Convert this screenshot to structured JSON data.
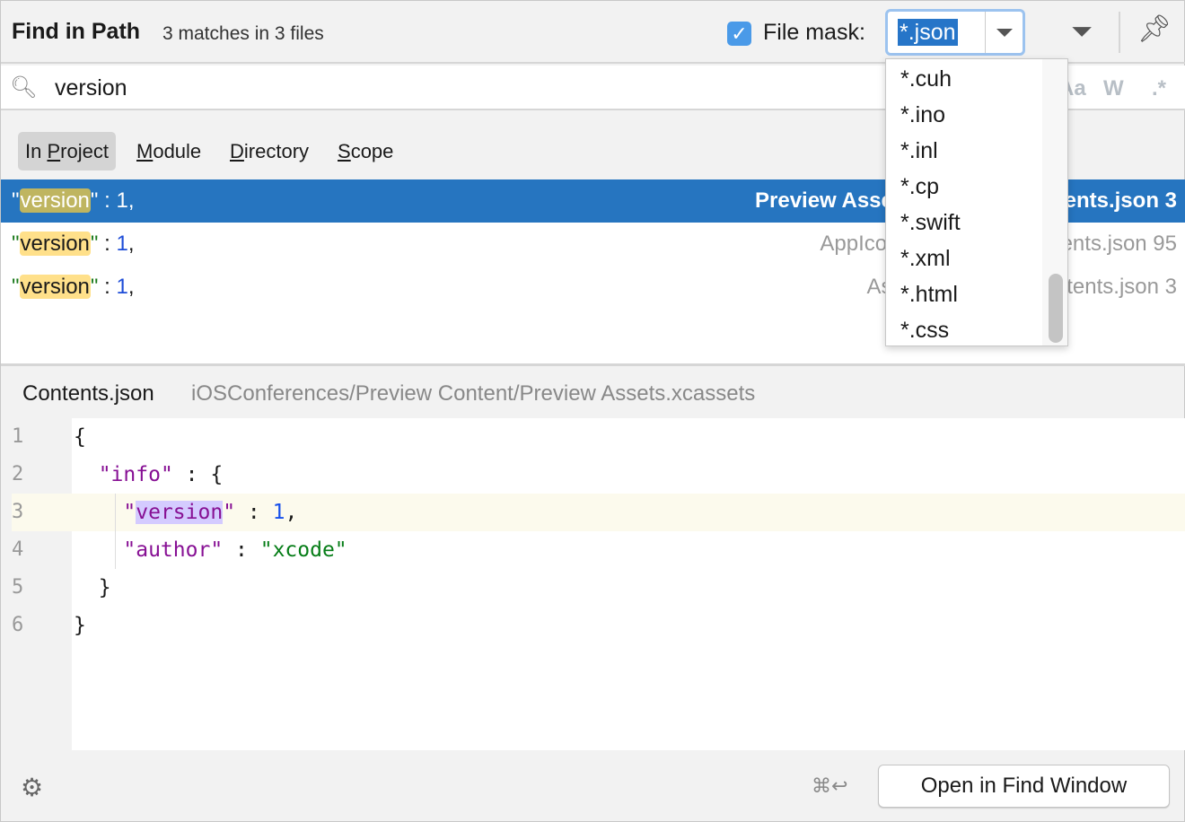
{
  "header": {
    "title": "Find in Path",
    "match_count": "3 matches in 3 files",
    "file_mask_checked": true,
    "file_mask_label": "File mask:",
    "file_mask_value": "*.json"
  },
  "search": {
    "value": "version",
    "options": {
      "match_case": "Aa",
      "words": "W",
      "regex": ".*"
    }
  },
  "scope_tabs": [
    {
      "pre": "In ",
      "key": "P",
      "post": "roject",
      "active": true
    },
    {
      "pre": "",
      "key": "M",
      "post": "odule"
    },
    {
      "pre": "",
      "key": "D",
      "post": "irectory"
    },
    {
      "pre": "",
      "key": "S",
      "post": "cope"
    }
  ],
  "results": [
    {
      "q1": "\"",
      "match": "version",
      "q2": "\"",
      "rest": " : ",
      "num": "1",
      "comma": ",",
      "location": "Preview Assets.xcassets/Contents.json 3",
      "selected": true
    },
    {
      "q1": "\"",
      "match": "version",
      "q2": "\"",
      "rest": " : ",
      "num": "1",
      "comma": ",",
      "location": "AppIcon.appiconset/Contents.json 95"
    },
    {
      "q1": "\"",
      "match": "version",
      "q2": "\"",
      "rest": " : ",
      "num": "1",
      "comma": ",",
      "location": "Assets.xcassets/Contents.json 3"
    }
  ],
  "mask_dropdown": [
    "*.cuh",
    "*.ino",
    "*.inl",
    "*.cp",
    "*.swift",
    "*.xml",
    "*.html",
    "*.css"
  ],
  "preview": {
    "file_name": "Contents.json",
    "file_path": "iOSConferences/Preview Content/Preview Assets.xcassets",
    "line_numbers": [
      "1",
      "2",
      "3",
      "4",
      "5",
      "6"
    ],
    "code": {
      "l1": "{",
      "l2_indent": "  ",
      "l2_key": "\"info\"",
      "l2_rest": " : {",
      "l3_indent": "    ",
      "l3_q1": "\"",
      "l3_key": "version",
      "l3_q2": "\"",
      "l3_rest": " : ",
      "l3_num": "1",
      "l3_comma": ",",
      "l4_indent": "    ",
      "l4_key": "\"author\"",
      "l4_rest": " : ",
      "l4_val": "\"xcode\"",
      "l5": "  }",
      "l6": "}"
    }
  },
  "footer": {
    "shortcut": "⌘↩",
    "open_button": "Open in Find Window"
  },
  "colors": {
    "accent": "#2675c0",
    "match_highlight": "#ffe08a",
    "checkbox": "#4a9ae8"
  }
}
